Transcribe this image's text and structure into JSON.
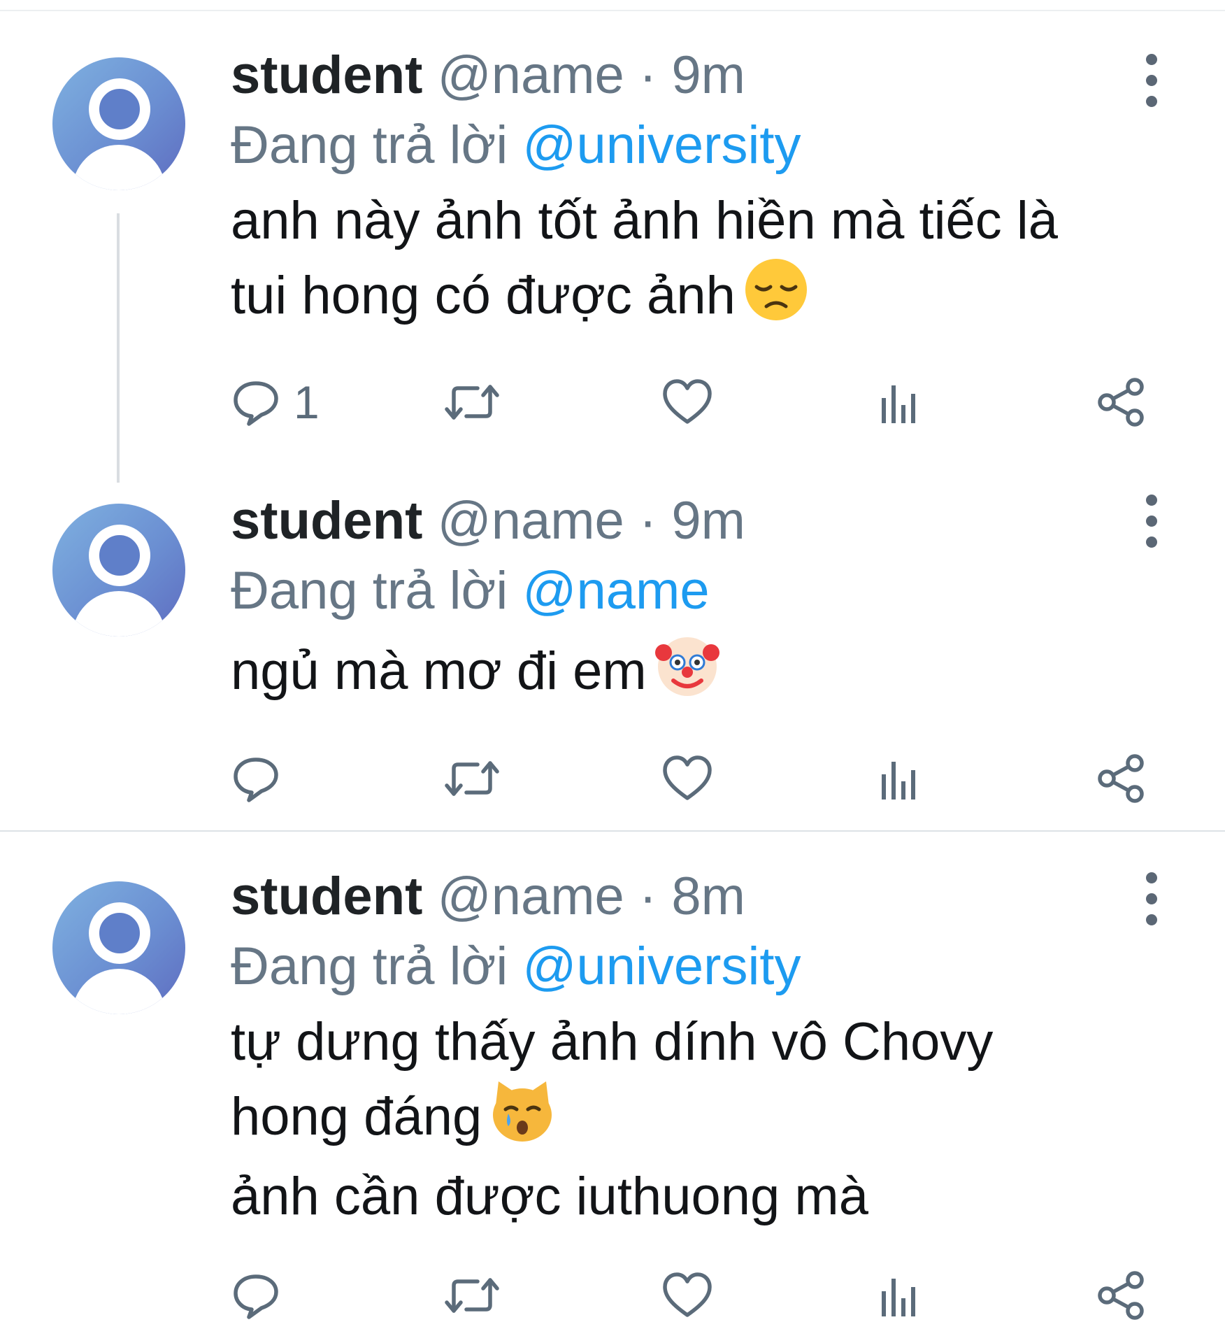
{
  "tweets": [
    {
      "name": "student",
      "handle": "@name",
      "dot": "·",
      "time": "9m",
      "replying_prefix": "Đang trả lời",
      "replying_to": "@university",
      "text_lines": [
        "anh này ảnh tốt ảnh hiền mà tiếc là",
        "tui hong có được ảnh"
      ],
      "emoji": "disappointed-face",
      "reply_count": "1"
    },
    {
      "name": "student",
      "handle": "@name",
      "dot": "·",
      "time": "9m",
      "replying_prefix": "Đang trả lời",
      "replying_to": "@name",
      "text_lines": [
        "ngủ mà mơ đi em"
      ],
      "emoji": "clown-face",
      "reply_count": ""
    },
    {
      "name": "student",
      "handle": "@name",
      "dot": "·",
      "time": "8m",
      "replying_prefix": "Đang trả lời",
      "replying_to": "@university",
      "text_lines": [
        "tự dưng thấy ảnh dính vô Chovy",
        "hong đáng",
        "ảnh cần được iuthuong mà"
      ],
      "emoji": "crying-cat-face",
      "reply_count": ""
    }
  ],
  "icons": {
    "reply": "reply-icon",
    "retweet": "retweet-icon",
    "like": "heart-icon",
    "views": "views-icon",
    "share": "share-icon",
    "more": "more-vertical-icon"
  },
  "colors": {
    "mention": "#1d9bf0",
    "muted": "#667685",
    "text": "#121417"
  }
}
